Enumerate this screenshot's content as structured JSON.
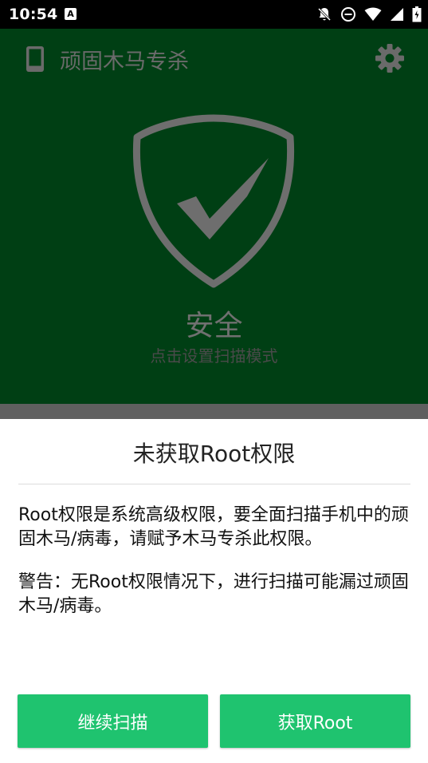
{
  "status_bar": {
    "time": "10:54",
    "notification_icon_letter": "A",
    "icons": [
      "notifications-off-icon",
      "do-not-disturb-icon",
      "wifi-icon",
      "signal-icon",
      "battery-icon"
    ]
  },
  "app": {
    "title": "顽固木马专杀",
    "status": "安全",
    "hint": "点击设置扫描模式",
    "background_color": "#003f14"
  },
  "dialog": {
    "title": "未获取Root权限",
    "message_1": "Root权限是系统高级权限，要全面扫描手机中的顽固木马/病毒，请赋予木马专杀此权限。",
    "message_2": "警告：无Root权限情况下，进行扫描可能漏过顽固木马/病毒。",
    "buttons": {
      "continue_label": "继续扫描",
      "get_root_label": "获取Root"
    },
    "accent_color": "#1fc36f"
  }
}
